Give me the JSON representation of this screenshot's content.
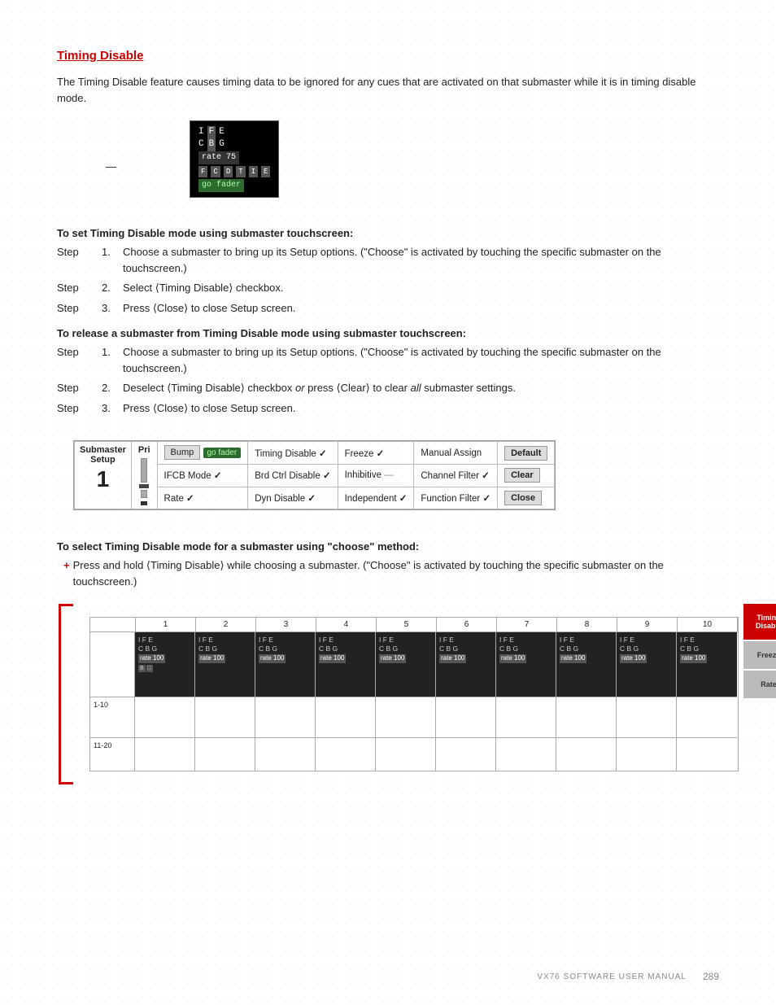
{
  "page": {
    "title": "Timing Disable",
    "intro": "The Timing Disable feature causes timing data to be ignored for any cues that are activated on that submaster while it is in timing disable mode.",
    "set_header": "To set Timing Disable mode using submaster touchscreen:",
    "set_steps": [
      "Choose a submaster to bring up its Setup options. (\"Choose\" is activated by touching the specific submaster on the touchscreen.)",
      "Select ⟨Timing Disable⟩ checkbox.",
      "Press ⟨Close⟩ to close Setup screen."
    ],
    "release_header": "To release a submaster from Timing Disable mode using submaster touchscreen:",
    "release_steps": [
      "Choose a submaster to bring up its Setup options. (\"Choose\" is activated by touching the specific submaster on the touchscreen.)",
      "Deselect ⟨Timing Disable⟩ checkbox or press ⟨Clear⟩ to clear all submaster settings.",
      "Press ⟨Close⟩ to close Setup screen."
    ],
    "select_header": "To select Timing Disable mode for a submaster using \"choose\" method:",
    "select_step": "Press and hold ⟨Timing Disable⟩ while choosing a submaster. (\"Choose\" is activated by touching the specific submaster on the touchscreen.)"
  },
  "setup_table": {
    "submaster_label": "Submaster\nSetup",
    "submaster_num": "1",
    "pri_label": "Pri",
    "row1": {
      "bump": "Bump",
      "go_fader": "go fader",
      "timing_disable": "Timing Disable",
      "timing_checked": "✓",
      "freeze": "Freeze",
      "freeze_checked": "✓",
      "manual_assign": "Manual Assign",
      "default": "Default"
    },
    "row2": {
      "ifcb_mode": "IFCB Mode",
      "ifcb_checked": "✓",
      "brd_ctrl_disable": "Brd Ctrl Disable",
      "brd_checked": "✓",
      "inhibitive": "Inhibitive",
      "inhibitive_dash": "—",
      "channel_filter": "Channel Filter",
      "channel_checked": "✓",
      "clear": "Clear"
    },
    "row3": {
      "rate": "Rate",
      "rate_checked": "✓",
      "dyn_disable": "Dyn Disable",
      "dyn_checked": "✓",
      "independent": "Independent",
      "independent_checked": "✓",
      "function_filter": "Function Filter",
      "function_checked": "✓",
      "close": "Close"
    }
  },
  "grid": {
    "header_cols": [
      "1",
      "2",
      "3",
      "4",
      "5",
      "6",
      "7",
      "8",
      "9",
      "10"
    ],
    "left_labels": [
      "1-10",
      "11-20"
    ],
    "right_buttons": [
      "Timing\nDisable",
      "Freeze",
      "Rate"
    ],
    "cell_content": "I F E\nC B G\nrate 100"
  },
  "footer": {
    "manual_name": "VX76 SOFTWARE USER MANUAL",
    "page_num": "289"
  }
}
